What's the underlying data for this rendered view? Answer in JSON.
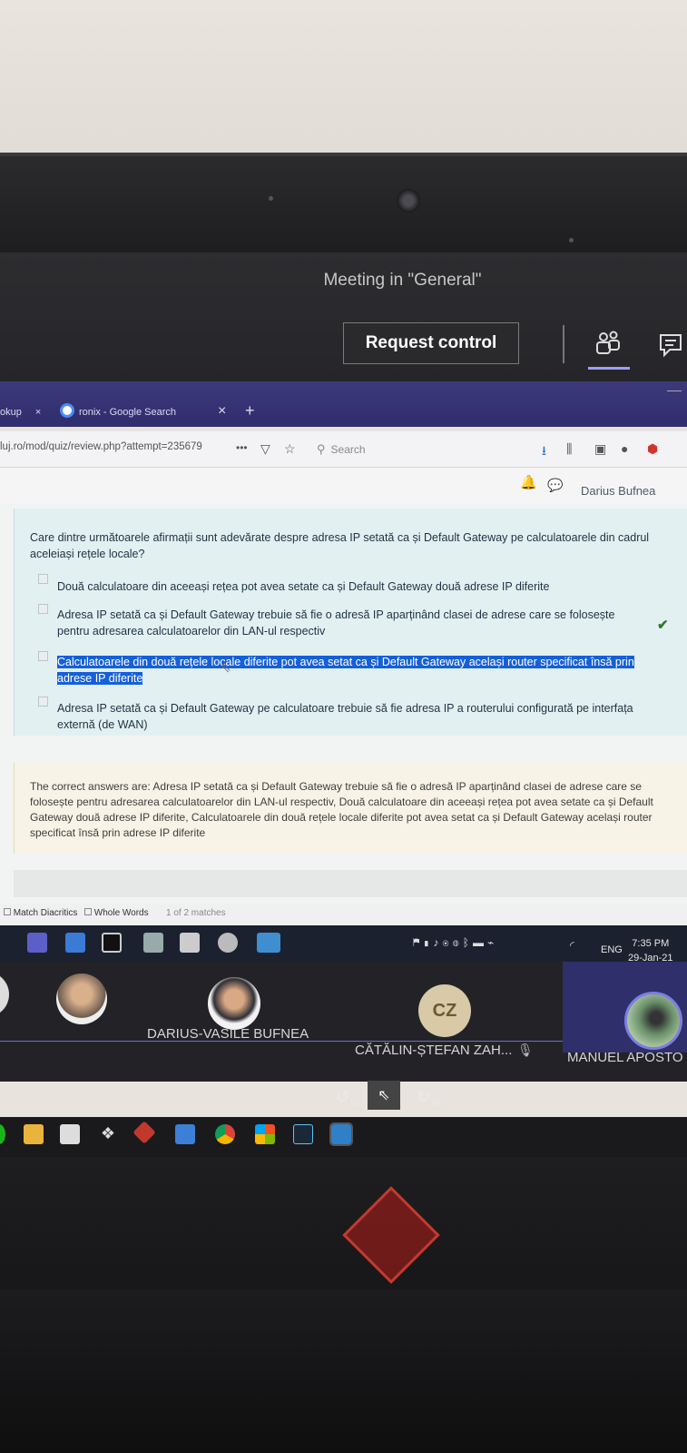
{
  "teams": {
    "meeting_title": "Meeting in \"General\"",
    "request_control_label": "Request control"
  },
  "browser": {
    "tabs": [
      "okup",
      "ronix - Google Search"
    ],
    "tab_close": "×",
    "new_tab": "+",
    "url": "luj.ro/mod/quiz/review.php?attempt=235679",
    "url_more": "•••",
    "search_placeholder": "Search"
  },
  "page": {
    "user_name": "Darius Bufnea",
    "question": "Care dintre următoarele afirmații sunt adevărate despre adresa IP setată ca și Default Gateway pe calculatoarele din cadrul aceleiași rețele locale?",
    "options": [
      "Două calculatoare din aceeași rețea pot avea setate ca și Default Gateway două adrese IP diferite",
      "Adresa IP setată ca și Default Gateway trebuie să fie o adresă IP aparținând clasei de adrese care se folosește pentru adresarea calculatoarelor din LAN-ul respectiv",
      "Calculatoarele din două rețele locale diferite pot avea setat ca și Default Gateway același router specificat însă prin adrese IP diferite",
      "Adresa IP setată ca și Default Gateway pe calculatoare trebuie să fie adresa IP a routerului configurată pe interfața externă (de WAN)"
    ],
    "correct_answer": "The correct answers are: Adresa IP setată ca și Default Gateway trebuie să fie o adresă IP aparținând clasei de adrese care se folosește pentru adresarea calculatoarelor din LAN-ul respectiv, Două calculatoare din aceeași rețea pot avea setate ca și Default Gateway două adrese IP diferite, Calculatoarele din două rețele locale diferite pot avea setat ca și Default Gateway același router specificat însă prin adrese IP diferite"
  },
  "findbar": {
    "match_diacritics": "Match Diacritics",
    "whole_words": "Whole Words",
    "matches": "1 of 2 matches"
  },
  "taskbar": {
    "language": "ENG",
    "time": "7:35 PM",
    "date": "29-Jan-21"
  },
  "participants": [
    {
      "name": "DARIUS-VASILE BUFNEA"
    },
    {
      "name": "CĂTĂLIN-ȘTEFAN ZAH...",
      "initials": "CZ"
    },
    {
      "name": "MANUEL APOSTO"
    }
  ],
  "share_controls": {
    "rewind_label": "10",
    "forward_label": "30"
  },
  "colors": {
    "teams_bar": "#2d2d30",
    "browser_tabstrip": "#3c3a7a",
    "question_bg": "#e3f0f1",
    "answer_bg": "#f7f3e6",
    "selection": "#1560d9",
    "correct": "#2a7a2a",
    "logo_red": "#c13a2e"
  }
}
